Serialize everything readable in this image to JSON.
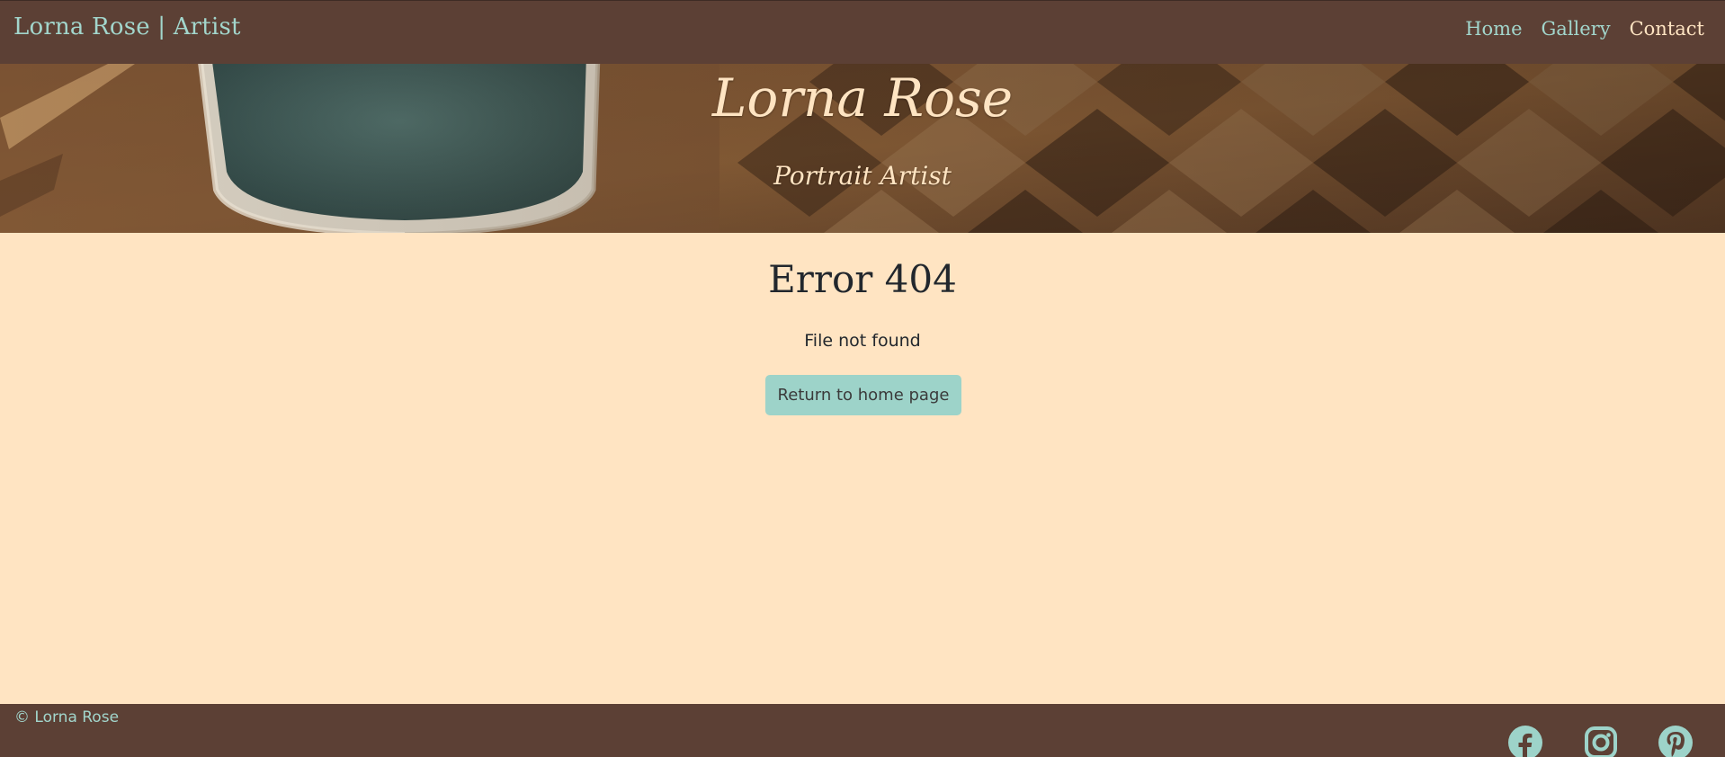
{
  "navbar": {
    "brand": "Lorna Rose | Artist",
    "links": [
      {
        "label": "Home"
      },
      {
        "label": "Gallery"
      },
      {
        "label": "Contact"
      }
    ]
  },
  "hero": {
    "title": "Lorna Rose",
    "subtitle": "Portrait Artist"
  },
  "main": {
    "heading": "Error 404",
    "message": "File not found",
    "button_label": "Return to home page"
  },
  "footer": {
    "copyright": "© Lorna Rose",
    "social_icons": [
      "facebook-icon",
      "instagram-icon",
      "pinterest-icon"
    ]
  },
  "colors": {
    "nav_background": "#5c4035",
    "accent": "#9dd3c9",
    "page_background": "#ffe4c2",
    "text_dark": "#22272d"
  }
}
